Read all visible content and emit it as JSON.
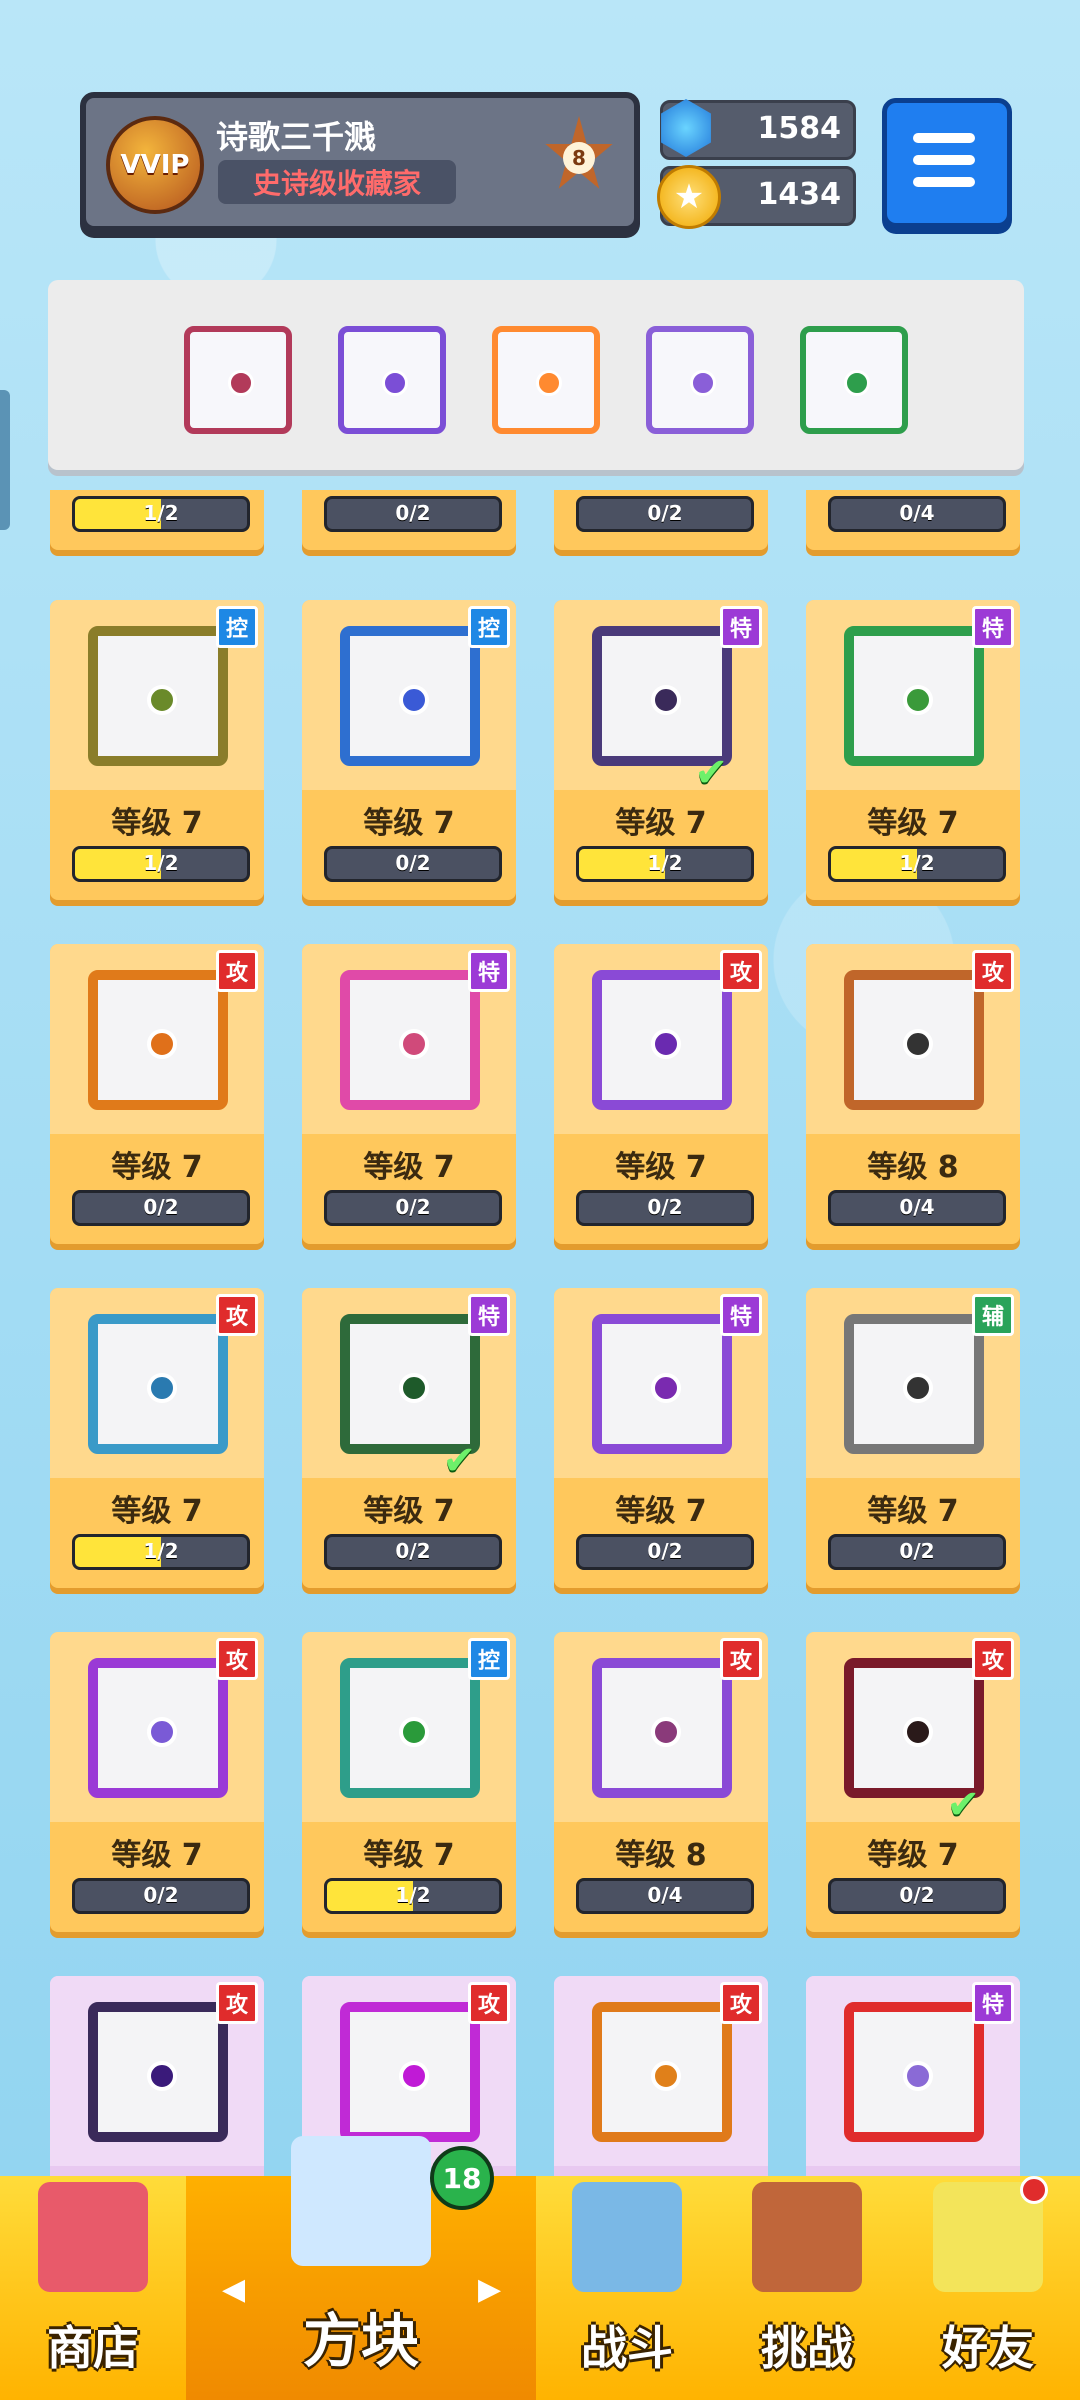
{
  "header": {
    "vip_label": "VVIP",
    "player_name": "诗歌三千溅",
    "player_title": "史诗级收藏家",
    "rank_level": "8",
    "gems": "1584",
    "coins": "1434"
  },
  "equipped": {
    "slots": [
      {
        "icon": "saw-blade-icon",
        "color": "#b23a5a"
      },
      {
        "icon": "purple-orb-icon",
        "color": "#7b4ed6"
      },
      {
        "icon": "infinity-icon",
        "color": "#ff8a30"
      },
      {
        "icon": "crack-icon",
        "color": "#8a5fd8"
      },
      {
        "icon": "vine-icon",
        "color": "#2e9e4c"
      }
    ]
  },
  "partial_row": [
    {
      "progress_text": "1/2",
      "progress": 0.5
    },
    {
      "progress_text": "0/2",
      "progress": 0
    },
    {
      "progress_text": "0/2",
      "progress": 0
    },
    {
      "progress_text": "0/4",
      "progress": 0
    }
  ],
  "cards": [
    {
      "level": "等级 7",
      "progress_text": "1/2",
      "progress": 0.5,
      "tag": "控",
      "tag_color": "#1e88e5",
      "frame": "#8a7d2a",
      "dot": "#6a8a2a",
      "checked": false
    },
    {
      "level": "等级 7",
      "progress_text": "0/2",
      "progress": 0,
      "tag": "控",
      "tag_color": "#1e88e5",
      "frame": "#2e6fd0",
      "dot": "#3a5ad6",
      "checked": false
    },
    {
      "level": "等级 7",
      "progress_text": "1/2",
      "progress": 0.5,
      "tag": "特",
      "tag_color": "#9c3ad6",
      "frame": "#4a3a7a",
      "dot": "#3a2a5a",
      "checked": true
    },
    {
      "level": "等级 7",
      "progress_text": "1/2",
      "progress": 0.5,
      "tag": "特",
      "tag_color": "#9c3ad6",
      "frame": "#2e9e4c",
      "dot": "#3a9a3a",
      "checked": false
    },
    {
      "level": "等级 7",
      "progress_text": "0/2",
      "progress": 0,
      "tag": "攻",
      "tag_color": "#e02c2c",
      "frame": "#e07a1a",
      "dot": "#e0701a",
      "checked": false
    },
    {
      "level": "等级 7",
      "progress_text": "0/2",
      "progress": 0,
      "tag": "特",
      "tag_color": "#9c3ad6",
      "frame": "#e04aa8",
      "dot": "#d04a7a",
      "checked": false
    },
    {
      "level": "等级 7",
      "progress_text": "0/2",
      "progress": 0,
      "tag": "攻",
      "tag_color": "#e02c2c",
      "frame": "#8a4ad6",
      "dot": "#6a2ab0",
      "checked": false
    },
    {
      "level": "等级 8",
      "progress_text": "0/4",
      "progress": 0,
      "tag": "攻",
      "tag_color": "#e02c2c",
      "frame": "#c0662a",
      "dot": "#333333",
      "checked": false
    },
    {
      "level": "等级 7",
      "progress_text": "1/2",
      "progress": 0.5,
      "tag": "攻",
      "tag_color": "#e02c2c",
      "frame": "#3a9ac8",
      "dot": "#2a7ab0",
      "checked": false
    },
    {
      "level": "等级 7",
      "progress_text": "0/2",
      "progress": 0,
      "tag": "特",
      "tag_color": "#9c3ad6",
      "frame": "#2e6a3a",
      "dot": "#1e5a2a",
      "checked": true
    },
    {
      "level": "等级 7",
      "progress_text": "0/2",
      "progress": 0,
      "tag": "特",
      "tag_color": "#9c3ad6",
      "frame": "#8a4ad6",
      "dot": "#7a2ab0",
      "checked": false
    },
    {
      "level": "等级 7",
      "progress_text": "0/2",
      "progress": 0,
      "tag": "辅",
      "tag_color": "#2aa35a",
      "frame": "#777777",
      "dot": "#333333",
      "checked": false
    },
    {
      "level": "等级 7",
      "progress_text": "0/2",
      "progress": 0,
      "tag": "攻",
      "tag_color": "#e02c2c",
      "frame": "#9a3ad6",
      "dot": "#7a5ad6",
      "checked": false
    },
    {
      "level": "等级 7",
      "progress_text": "1/2",
      "progress": 0.5,
      "tag": "控",
      "tag_color": "#1e88e5",
      "frame": "#2e9e8a",
      "dot": "#2a9a3a",
      "checked": false
    },
    {
      "level": "等级 8",
      "progress_text": "0/4",
      "progress": 0,
      "tag": "攻",
      "tag_color": "#e02c2c",
      "frame": "#8a4ad6",
      "dot": "#8a3a7a",
      "checked": false
    },
    {
      "level": "等级 7",
      "progress_text": "0/2",
      "progress": 0,
      "tag": "攻",
      "tag_color": "#e02c2c",
      "frame": "#7a1a2a",
      "dot": "#2a1a1a",
      "checked": true
    }
  ],
  "locked_row": [
    {
      "tag": "攻",
      "tag_color": "#e02c2c",
      "frame": "#3a2a5a",
      "dot": "#3a1a7a"
    },
    {
      "tag": "攻",
      "tag_color": "#e02c2c",
      "frame": "#c02ad6",
      "dot": "#c01ad6"
    },
    {
      "tag": "攻",
      "tag_color": "#e02c2c",
      "frame": "#e07a1a",
      "dot": "#e0801a"
    },
    {
      "tag": "特",
      "tag_color": "#9c3ad6",
      "frame": "#e02c2c",
      "dot": "#8a6ad6"
    }
  ],
  "nav": {
    "shop": "商店",
    "blocks": "方块",
    "blocks_badge": "18",
    "battle": "战斗",
    "challenge": "挑战",
    "friends": "好友"
  }
}
